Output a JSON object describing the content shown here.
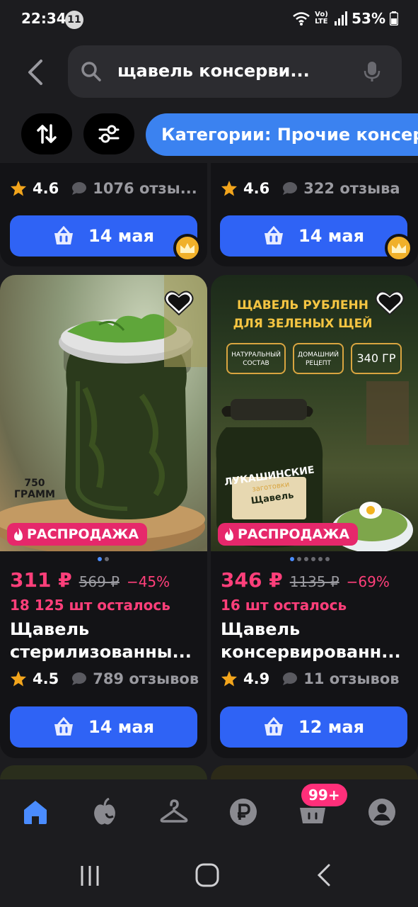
{
  "status_bar": {
    "time": "22:34",
    "notification_count": "11",
    "network": "Vo) LTE",
    "battery": "53%"
  },
  "search": {
    "query": "щавель консерви..."
  },
  "filters": {
    "category_chip": "Категории: Прочие консер"
  },
  "top_cards": [
    {
      "rating": "4.6",
      "reviews": "1076 отзы...",
      "delivery": "14 мая"
    },
    {
      "rating": "4.6",
      "reviews": "322 отзыва",
      "delivery": "14 мая"
    }
  ],
  "products": [
    {
      "sale_label": "РАСПРОДАЖА",
      "image_text": [
        "750",
        "ГРАММ"
      ],
      "price": "311 ₽",
      "old_price": "569 ₽",
      "discount": "−45%",
      "stock": "18 125 шт осталось",
      "title_line1": "Щавель",
      "title_line2": "стерилизованны...",
      "rating": "4.5",
      "reviews": "789 отзывов",
      "delivery": "14 мая",
      "image_dots": 2
    },
    {
      "sale_label": "РАСПРОДАЖА",
      "image_text": [
        "ЩАВЕЛЬ РУБЛЕНН",
        "ДЛЯ ЗЕЛЕНЫХ ЩЕЙ",
        "НАТУРАЛЬНЫЙ СОСТАВ",
        "ДОМАШНИЙ РЕЦЕПТ",
        "340 ГР",
        "ЛУКАШИНСКИЕ",
        "заготовки",
        "Щавель"
      ],
      "price": "346 ₽",
      "old_price": "1135 ₽",
      "discount": "−69%",
      "stock": "16 шт осталось",
      "title_line1": "Щавель",
      "title_line2": "консервированн...",
      "rating": "4.9",
      "reviews": "11 отзывов",
      "delivery": "12 мая",
      "image_dots": 6
    }
  ],
  "bottom_nav": {
    "cart_badge": "99+"
  },
  "colors": {
    "accent": "#2f63f5",
    "sale": "#e6286b",
    "price": "#ff3f7a",
    "chip": "#3b82f0"
  }
}
